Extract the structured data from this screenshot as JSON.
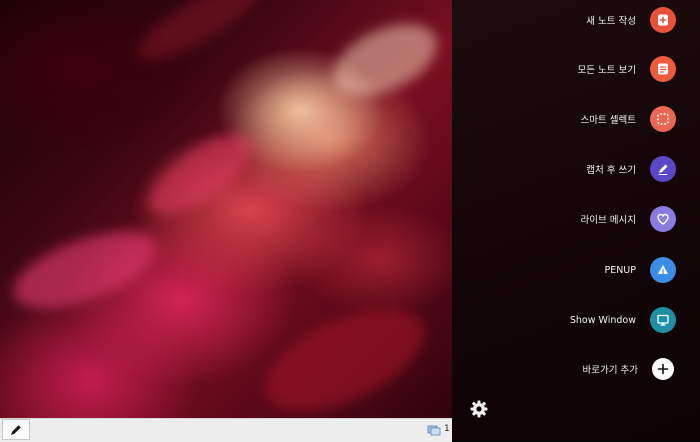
{
  "air_command": {
    "items": [
      {
        "label": "새 노트 작성",
        "icon": "new-note-icon",
        "color": "#e8503a"
      },
      {
        "label": "모든 노트 보기",
        "icon": "all-notes-icon",
        "color": "#ee5b3c"
      },
      {
        "label": "스마트 셀렉트",
        "icon": "smart-select-icon",
        "color": "#e96652"
      },
      {
        "label": "캡처 후 쓰기",
        "icon": "screen-write-icon",
        "color": "#5b48c4"
      },
      {
        "label": "라이브 메시지",
        "icon": "live-message-icon",
        "color": "#8a7ce0"
      },
      {
        "label": "PENUP",
        "icon": "penup-icon",
        "color": "#3d8ce8"
      },
      {
        "label": "Show Window",
        "icon": "show-window-icon",
        "color": "#1d90a6"
      },
      {
        "label": "바로가기 추가",
        "icon": "add-shortcut-icon",
        "color": "#ffffff"
      }
    ],
    "settings_icon": "gear-icon"
  },
  "taskbar": {
    "pen_icon": "pen-icon",
    "tray_icon": "network-icon",
    "tray_text": "1"
  }
}
